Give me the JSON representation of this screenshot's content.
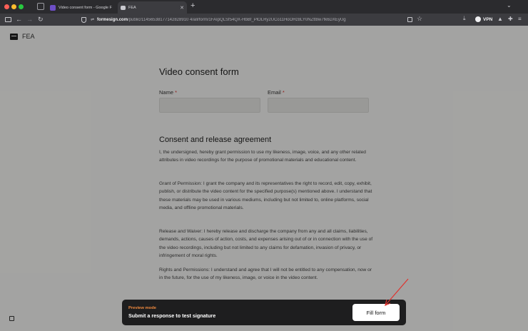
{
  "browser": {
    "tabs": [
      {
        "title": "Video consent form - Google F",
        "active": false
      },
      {
        "title": "FEA",
        "active": true
      }
    ],
    "new_tab_label": "+",
    "url_domain": "formesign.com",
    "url_path": "/public/11456538177142828910 4/all/form/1FAIpQLSf54QX-HbBf_PlOLRy2UCo11HoOHz8LY0NZtt8w7fk6DXEyUg",
    "vpn_label": "VPN"
  },
  "page": {
    "brand_name": "FEA",
    "form_title": "Video consent form",
    "fields": [
      {
        "label": "Name",
        "required_mark": "*",
        "value": ""
      },
      {
        "label": "Email",
        "required_mark": "*",
        "value": ""
      }
    ],
    "section_title": "Consent and release agreement",
    "paragraphs": [
      "I, the undersigned, hereby grant permission to use my likeness, image, voice, and any other related attributes in video recordings for the purpose of promotional materials and educational content.",
      "Grant of Permission: I grant the company and its representatives the right to record, edit, copy, exhibit, publish, or distribute the video content for the specified purpose(s) mentioned above. I understand that these materials may be used in various mediums, including but not limited to, online platforms, social media, and offline promotional materials.",
      "Release and Waiver: I hereby release and discharge the company from any and all claims, liabilities, demands, actions, causes of action, costs, and expenses arising out of or in connection with the use of the video recordings, including but not limited to any claims for defamation, invasion of privacy, or infringement of moral rights.",
      "Rights and Permissions: I understand and agree that I will not be entitled to any compensation, now or in the future, for the use of my likeness, image, or voice in the video content."
    ]
  },
  "preview_bar": {
    "mode_label": "Preview mode",
    "message": "Submit a response to test signature",
    "button_label": "Fill form"
  },
  "colors": {
    "preview_accent": "#f08a3e",
    "annotation_arrow": "#e0322d",
    "required_mark": "#d6322e"
  }
}
